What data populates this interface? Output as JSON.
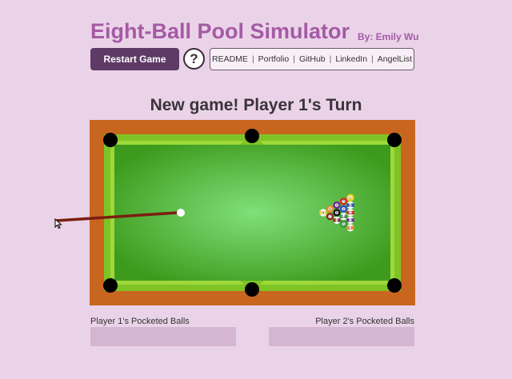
{
  "header": {
    "title": "Eight-Ball Pool Simulator",
    "byline": "By: Emily Wu"
  },
  "controls": {
    "restart_label": "Restart Game",
    "help_label": "?",
    "links": [
      "README",
      "Portfolio",
      "GitHub",
      "LinkedIn",
      "AngelList"
    ]
  },
  "game": {
    "status": "New game! Player 1's Turn",
    "balls": [
      {
        "num": "9",
        "color": "#f2d22e",
        "stripe": true
      },
      {
        "num": "5",
        "color": "#f08a24",
        "stripe": false
      },
      {
        "num": "7",
        "color": "#8b2a1e",
        "stripe": false
      },
      {
        "num": "4",
        "color": "#6b2a8f",
        "stripe": false
      },
      {
        "num": "8",
        "color": "#111111",
        "stripe": false
      },
      {
        "num": "15",
        "color": "#8b2a1e",
        "stripe": true
      },
      {
        "num": "3",
        "color": "#d8261e",
        "stripe": false
      },
      {
        "num": "2",
        "color": "#2a4ec6",
        "stripe": false
      },
      {
        "num": "14",
        "color": "#2a9a3a",
        "stripe": true
      },
      {
        "num": "6",
        "color": "#2a9a3a",
        "stripe": false
      },
      {
        "num": "1",
        "color": "#f2d22e",
        "stripe": false
      },
      {
        "num": "10",
        "color": "#2a4ec6",
        "stripe": true
      },
      {
        "num": "11",
        "color": "#d8261e",
        "stripe": true
      },
      {
        "num": "12",
        "color": "#6b2a8f",
        "stripe": true
      },
      {
        "num": "13",
        "color": "#f08a24",
        "stripe": true
      }
    ]
  },
  "players": {
    "p1_label": "Player 1's Pocketed Balls",
    "p2_label": "Player 2's Pocketed Balls"
  },
  "colors": {
    "rail": "#c8661f",
    "cushion": "#7fc426",
    "felt_center": "#7fe07a",
    "felt_edge": "#3e9a1c",
    "cue": "#7a1e10",
    "accent": "#a55aa5"
  }
}
